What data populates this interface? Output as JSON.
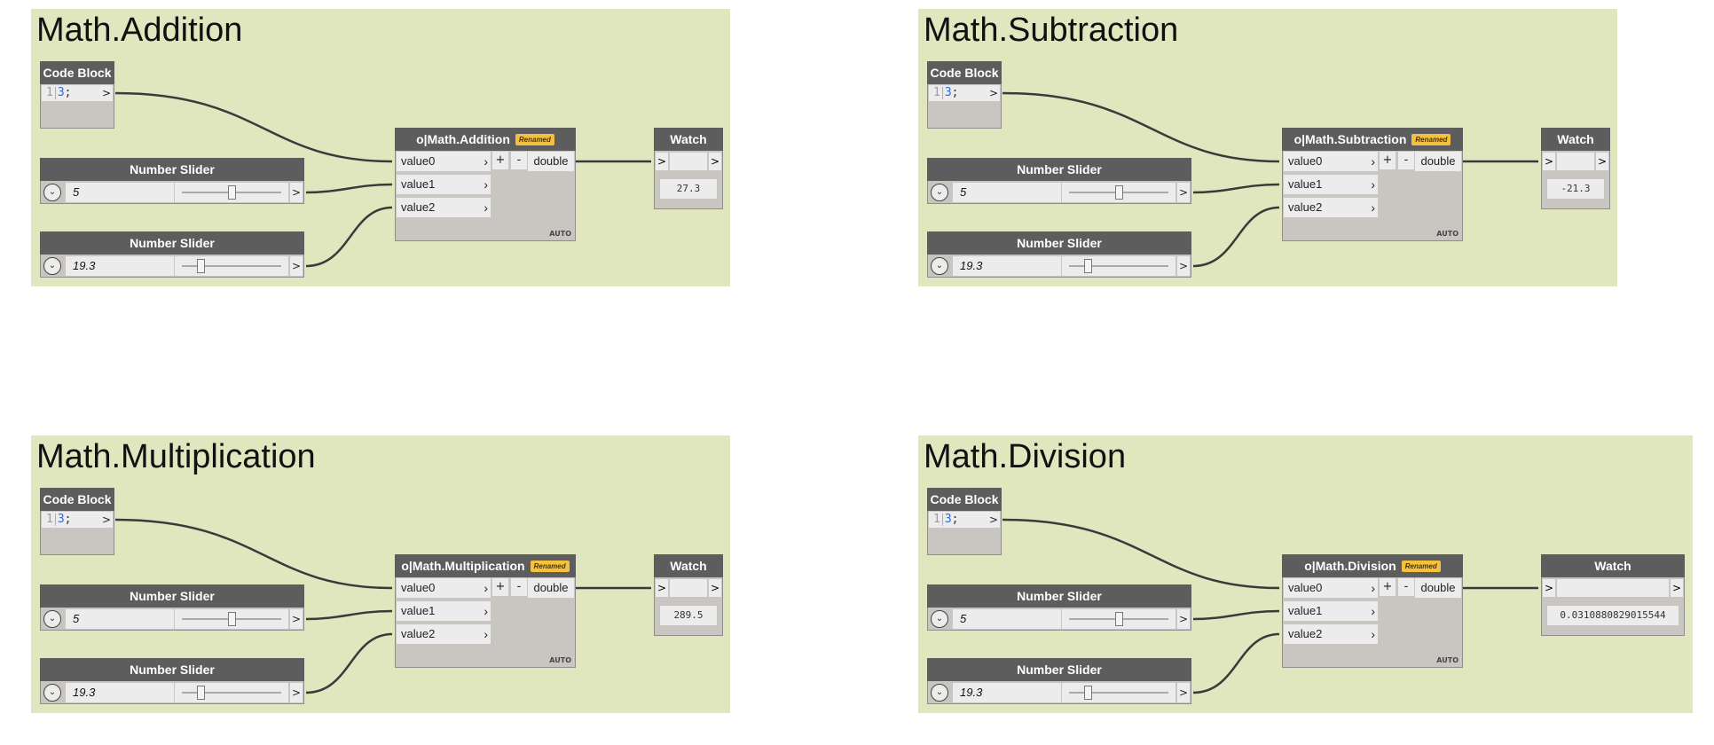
{
  "groups": [
    {
      "title": "Math.Addition",
      "code_block": {
        "header": "Code Block",
        "line_number": "1",
        "code": "3",
        "terminator": ";",
        "out": ">"
      },
      "slider_a": {
        "header": "Number Slider",
        "value": "5",
        "position": 0.5,
        "expand": "⌄",
        "out": ">"
      },
      "slider_b": {
        "header": "Number Slider",
        "value": "19.3",
        "position": 0.19,
        "expand": "⌄",
        "out": ">"
      },
      "math_node": {
        "title": "o|Math.Addition",
        "badge": "Renamed",
        "inputs": [
          "value0",
          "value1",
          "value2"
        ],
        "plus": "+",
        "minus": "-",
        "output": "double",
        "lacing": "AUTO"
      },
      "watch": {
        "header": "Watch",
        "in": ">",
        "out": ">",
        "value": "27.3"
      }
    },
    {
      "title": "Math.Subtraction",
      "code_block": {
        "header": "Code Block",
        "line_number": "1",
        "code": "3",
        "terminator": ";",
        "out": ">"
      },
      "slider_a": {
        "header": "Number Slider",
        "value": "5",
        "position": 0.5,
        "expand": "⌄",
        "out": ">"
      },
      "slider_b": {
        "header": "Number Slider",
        "value": "19.3",
        "position": 0.19,
        "expand": "⌄",
        "out": ">"
      },
      "math_node": {
        "title": "o|Math.Subtraction",
        "badge": "Renamed",
        "inputs": [
          "value0",
          "value1",
          "value2"
        ],
        "plus": "+",
        "minus": "-",
        "output": "double",
        "lacing": "AUTO"
      },
      "watch": {
        "header": "Watch",
        "in": ">",
        "out": ">",
        "value": "-21.3"
      }
    },
    {
      "title": "Math.Multiplication",
      "code_block": {
        "header": "Code Block",
        "line_number": "1",
        "code": "3",
        "terminator": ";",
        "out": ">"
      },
      "slider_a": {
        "header": "Number Slider",
        "value": "5",
        "position": 0.5,
        "expand": "⌄",
        "out": ">"
      },
      "slider_b": {
        "header": "Number Slider",
        "value": "19.3",
        "position": 0.19,
        "expand": "⌄",
        "out": ">"
      },
      "math_node": {
        "title": "o|Math.Multiplication",
        "badge": "Renamed",
        "inputs": [
          "value0",
          "value1",
          "value2"
        ],
        "plus": "+",
        "minus": "-",
        "output": "double",
        "lacing": "AUTO"
      },
      "watch": {
        "header": "Watch",
        "in": ">",
        "out": ">",
        "value": "289.5"
      }
    },
    {
      "title": "Math.Division",
      "code_block": {
        "header": "Code Block",
        "line_number": "1",
        "code": "3",
        "terminator": ";",
        "out": ">"
      },
      "slider_a": {
        "header": "Number Slider",
        "value": "5",
        "position": 0.5,
        "expand": "⌄",
        "out": ">"
      },
      "slider_b": {
        "header": "Number Slider",
        "value": "19.3",
        "position": 0.19,
        "expand": "⌄",
        "out": ">"
      },
      "math_node": {
        "title": "o|Math.Division",
        "badge": "Renamed",
        "inputs": [
          "value0",
          "value1",
          "value2"
        ],
        "plus": "+",
        "minus": "-",
        "output": "double",
        "lacing": "AUTO"
      },
      "watch": {
        "header": "Watch",
        "in": ">",
        "out": ">",
        "value": "0.0310880829015544"
      }
    }
  ],
  "colors": {
    "group_background": "#e0e7be",
    "node_header": "#5d5d5d",
    "node_body": "#c9c6c1",
    "wire": "#3a3a3a",
    "badge": "#f3c040",
    "code_number": "#2a6cd6"
  }
}
